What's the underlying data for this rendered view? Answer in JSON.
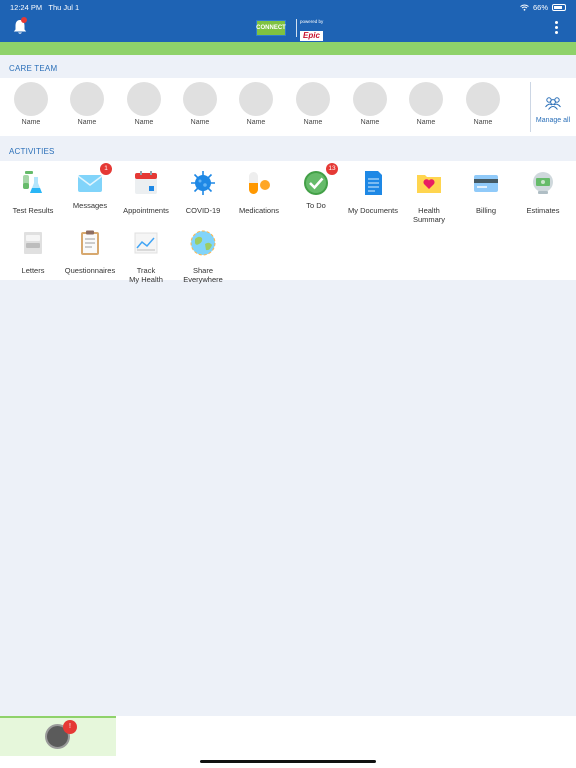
{
  "status_bar": {
    "time": "12:24 PM",
    "date": "Thu Jul 1",
    "battery": "66%"
  },
  "header": {
    "connect_logo": "CONNECT",
    "powered_by": "powered by",
    "epic_logo": "Epic"
  },
  "care_team": {
    "title": "CARE TEAM",
    "members": [
      "Name",
      "Name",
      "Name",
      "Name",
      "Name",
      "Name",
      "Name",
      "Name",
      "Name"
    ],
    "manage_label": "Manage all"
  },
  "activities": {
    "title": "ACTIVITIES",
    "items": [
      {
        "label": "Test Results",
        "icon": "test-tubes-icon"
      },
      {
        "label": "Messages",
        "icon": "envelope-icon",
        "badge": "1"
      },
      {
        "label": "Appointments",
        "icon": "calendar-icon"
      },
      {
        "label": "COVID-19",
        "icon": "virus-icon"
      },
      {
        "label": "Medications",
        "icon": "pills-icon"
      },
      {
        "label": "To Do",
        "icon": "checkmark-icon",
        "badge": "13"
      },
      {
        "label": "My Documents",
        "icon": "document-icon"
      },
      {
        "label": "Health\nSummary",
        "icon": "heart-folder-icon"
      },
      {
        "label": "Billing",
        "icon": "credit-card-icon"
      },
      {
        "label": "Estimates",
        "icon": "estimate-icon"
      },
      {
        "label": "Letters",
        "icon": "letter-stack-icon"
      },
      {
        "label": "Questionnaires",
        "icon": "clipboard-icon"
      },
      {
        "label": "Track\nMy Health",
        "icon": "chart-icon"
      },
      {
        "label": "Share\nEverywhere",
        "icon": "globe-icon"
      }
    ]
  },
  "bottom_bar": {
    "badge": "!"
  },
  "colors": {
    "primary": "#1e63b4",
    "accent_green": "#8fd26a",
    "badge_red": "#e53935",
    "section_bg": "#edf1f8"
  }
}
